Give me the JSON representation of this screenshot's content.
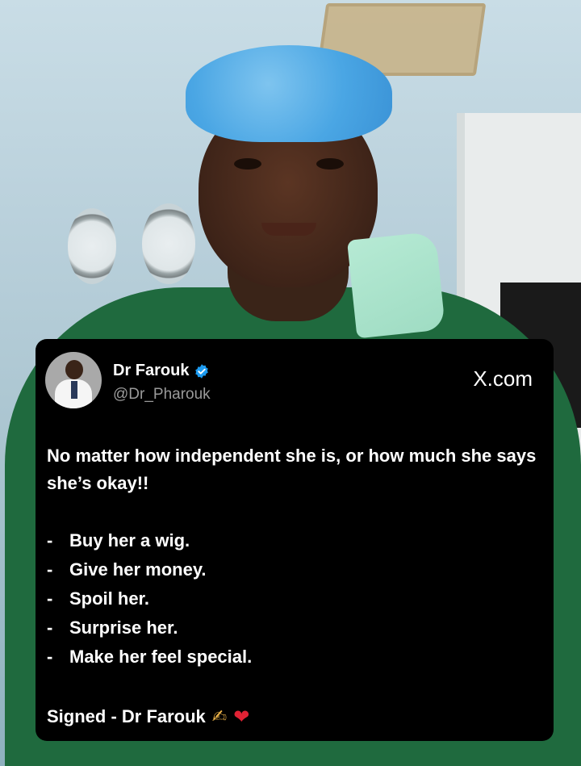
{
  "tweet": {
    "display_name": "Dr Farouk",
    "handle": "@Dr_Pharouk",
    "source": "X.com",
    "intro": "No matter how independent she is, or how much she says she’s okay!!",
    "bullets": [
      "Buy her a wig.",
      "Give her money.",
      "Spoil her.",
      "Surprise her.",
      "Make her feel special."
    ],
    "bullet_marker": "-",
    "signature": "Signed - Dr Farouk",
    "icons": {
      "verified": "verified-badge-icon",
      "writing_hand": "writing-hand-icon",
      "heart": "heart-icon"
    }
  },
  "colors": {
    "card_bg": "#000000",
    "verified_blue": "#1d9bf0",
    "handle_gray": "#9a9a9a",
    "heart_red": "#e02234",
    "scrubs_green": "#1f6a3e",
    "cap_blue": "#4aa6e4"
  }
}
